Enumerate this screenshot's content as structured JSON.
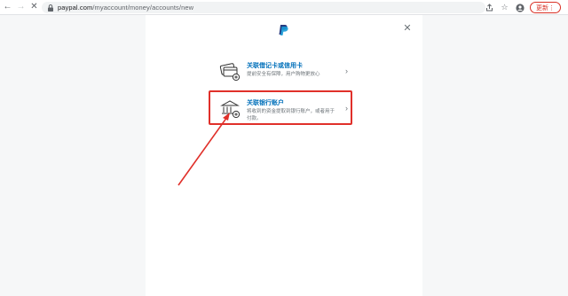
{
  "browser": {
    "back_icon": "arrow-left-icon",
    "forward_icon": "arrow-right-icon",
    "stop_icon": "close-icon",
    "url_host": "paypal.com",
    "url_path": "/myaccount/money/accounts/new",
    "update_label": "更新"
  },
  "modal": {
    "options": [
      {
        "title": "关联借记卡或信用卡",
        "description": "提前安全有保障，用户购物更放心",
        "icon": "credit-card-add-icon"
      },
      {
        "title": "关联银行账户",
        "description": "将收到的资金提取到银行账户，或者用于付款。",
        "icon": "bank-add-icon"
      }
    ]
  },
  "colors": {
    "accent": "#0070ba",
    "highlight": "#e0302a"
  }
}
